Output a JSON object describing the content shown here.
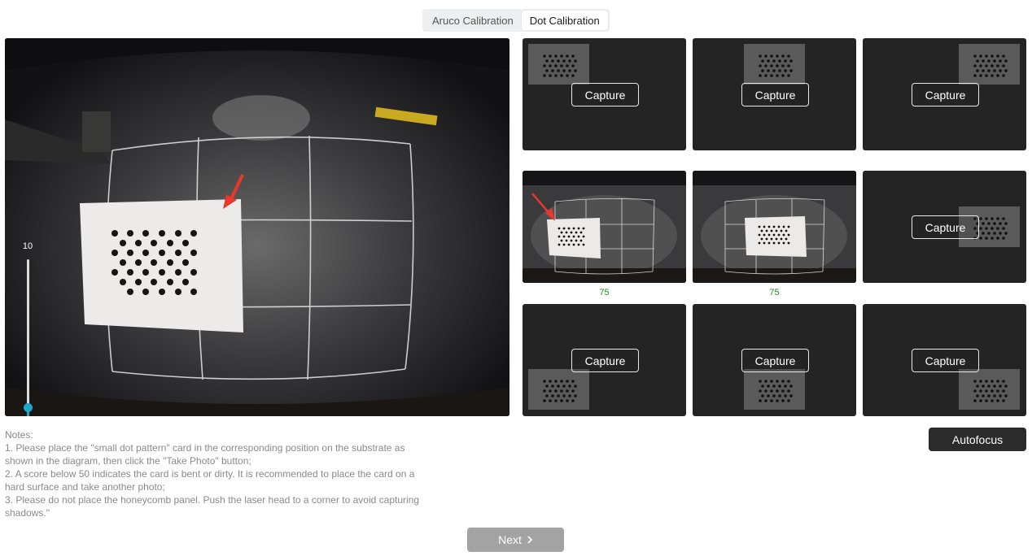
{
  "tabs": [
    {
      "label": "Aruco Calibration",
      "active": false
    },
    {
      "label": "Dot Calibration",
      "active": true
    }
  ],
  "camera": {
    "brightness_value": "10",
    "brightness_level": 0.1,
    "brightness_icon": "brightness-icon",
    "arrow_icon": "red-arrow-icon"
  },
  "slots": [
    {
      "capture_label": "Capture",
      "marker": "top-left"
    },
    {
      "capture_label": "Capture",
      "marker": "top-center"
    },
    {
      "capture_label": "Capture",
      "marker": "top-right"
    },
    {
      "score": "75",
      "photo": true
    },
    {
      "score": "75",
      "photo": true
    },
    {
      "capture_label": "Capture",
      "marker": "middle-right"
    },
    {
      "capture_label": "Capture",
      "marker": "bottom-left"
    },
    {
      "capture_label": "Capture",
      "marker": "bottom-center"
    },
    {
      "capture_label": "Capture",
      "marker": "bottom-right"
    }
  ],
  "autofocus_label": "Autofocus",
  "notes": {
    "title": "Notes:",
    "lines": [
      "1. Please place the \"small dot pattern\" card in the corresponding position on the substrate as shown in the diagram, then click the \"Take Photo\" button;",
      "2. A score below 50 indicates the card is bent or dirty. It is recommended to place the card on a hard surface and take another photo;",
      "3. Please do not place the honeycomb panel. Push the laser head to a corner to avoid capturing shadows.\""
    ]
  },
  "next_label": "Next",
  "next_icon": "chevron-right-icon",
  "colors": {
    "accent": "#1ca8c8",
    "score": "#1f8f1f",
    "arrow": "#e8382d"
  }
}
